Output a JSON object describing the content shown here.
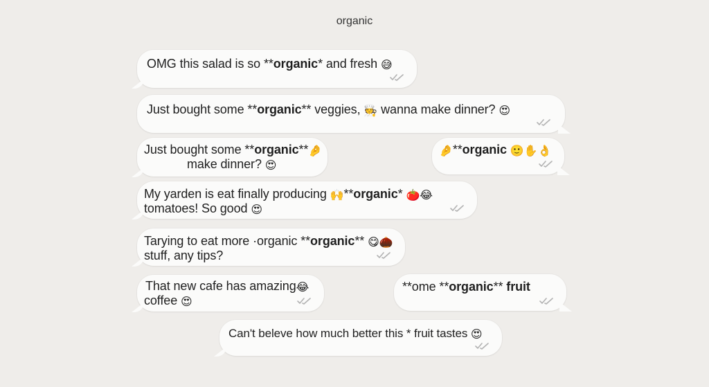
{
  "chat": {
    "title": "organic"
  },
  "messages": [
    {
      "id": "m1",
      "line1_pre": "OMG this salad is so **",
      "line1_bold": "organic",
      "line1_post": "* and fresh",
      "emoji1": "😅"
    },
    {
      "id": "m2",
      "line1_pre": "Just bought some **",
      "line1_bold": "organic",
      "line1_post": "** veggies,",
      "emoji1": "🧑‍🍳",
      "line1_post2": "wanna make dinner?",
      "emoji2": "😍"
    },
    {
      "id": "m3",
      "line1_pre": "Just bought some **",
      "line1_bold": "organic",
      "line1_post": "**",
      "emoji1": "🤌",
      "line2": "make dinner?",
      "emoji2": "😍"
    },
    {
      "id": "m4",
      "emoji_lead": "🤌",
      "line1_pre": "**",
      "line1_bold": "organic",
      "emoji1": "🙂",
      "emoji2": "✋",
      "emoji3": "👌"
    },
    {
      "id": "m5",
      "line1_pre": "My yarden is eat finally producing",
      "emoji1": "🙌",
      "line1_mid": "**",
      "line1_bold": "organic",
      "line1_post": "*",
      "emoji2": "🍅",
      "emoji3": "😂",
      "line2": "tomatoes! So good",
      "emoji4": "😍"
    },
    {
      "id": "m6",
      "line1_pre": "Tarying to eat more ·organic **",
      "line1_bold": "organic",
      "line1_post": "**",
      "emoji1": "😋",
      "emoji2": "🌰",
      "line2": "stuff, any tips?"
    },
    {
      "id": "m7",
      "line1_pre": "That new cafe has amazing",
      "emoji1": "😂",
      "line2": "coffee",
      "emoji2": "😍"
    },
    {
      "id": "m8",
      "line1_pre": "**ome **",
      "line1_bold": "organic",
      "line1_post": "** ",
      "line1_bold2": "fruit"
    },
    {
      "id": "m9",
      "line1_pre": "Can't beleve how much better this * fruit tastes",
      "emoji1": "😍"
    }
  ],
  "colors": {
    "background": "#efedea",
    "bubble": "#fbfbfa",
    "text": "#1f1f1f",
    "checkmark": "#b4b4b4"
  },
  "icons": {
    "read_receipt": "double-check-icon"
  }
}
